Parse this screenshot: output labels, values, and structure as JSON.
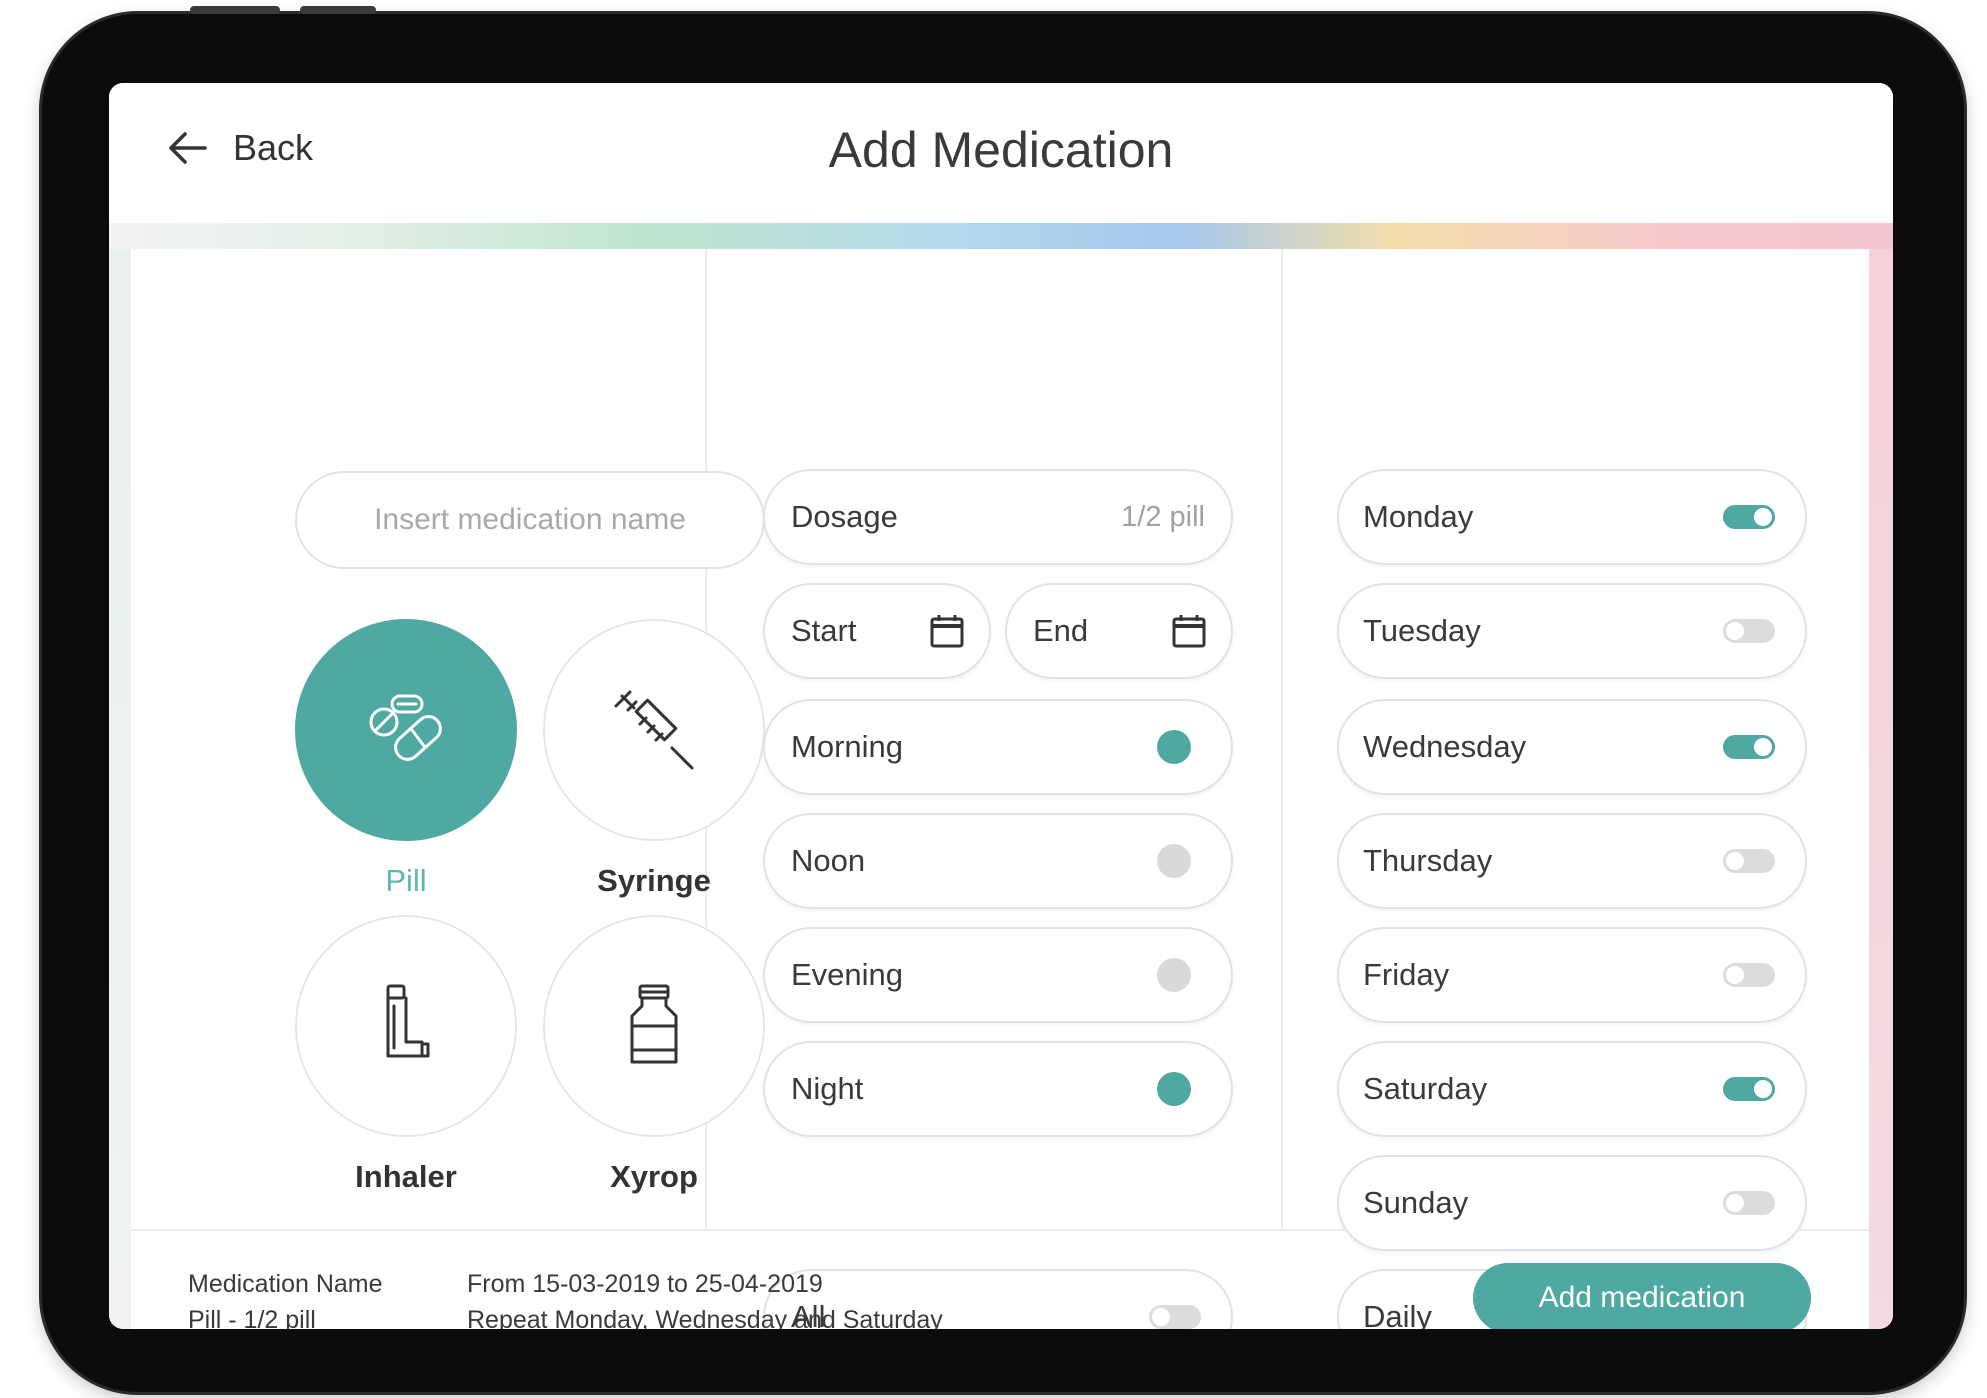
{
  "header": {
    "back_label": "Back",
    "title": "Add Medication"
  },
  "name_field": {
    "placeholder": "Insert medication name",
    "value": ""
  },
  "types": [
    {
      "label": "Pill",
      "icon": "pill-icon",
      "selected": true
    },
    {
      "label": "Syringe",
      "icon": "syringe-icon",
      "selected": false
    },
    {
      "label": "Inhaler",
      "icon": "inhaler-icon",
      "selected": false
    },
    {
      "label": "Xyrop",
      "icon": "syrup-bottle-icon",
      "selected": false
    }
  ],
  "dosage": {
    "label": "Dosage",
    "value": "1/2 pill"
  },
  "dates": {
    "start_label": "Start",
    "end_label": "End"
  },
  "times": [
    {
      "label": "Morning",
      "active": true
    },
    {
      "label": "Noon",
      "active": false
    },
    {
      "label": "Evening",
      "active": false
    },
    {
      "label": "Night",
      "active": true
    }
  ],
  "all_toggle": {
    "label": "All",
    "on": false
  },
  "days": [
    {
      "label": "Monday",
      "on": true
    },
    {
      "label": "Tuesday",
      "on": false
    },
    {
      "label": "Wednesday",
      "on": true
    },
    {
      "label": "Thursday",
      "on": false
    },
    {
      "label": "Friday",
      "on": false
    },
    {
      "label": "Saturday",
      "on": true
    },
    {
      "label": "Sunday",
      "on": false
    },
    {
      "label": "Daily",
      "on": false
    }
  ],
  "summary": {
    "name_line": "Medication Name",
    "type_line": "Pill - 1/2 pill",
    "date_line": "From 15-03-2019 to 25-04-2019",
    "repeat_line": "Repeat Monday, Wednesday and Saturday"
  },
  "add_button_label": "Add medication",
  "colors": {
    "accent": "#4fa8a2",
    "toggle_off": "#dcdcdc",
    "border": "#e2e2e2"
  }
}
